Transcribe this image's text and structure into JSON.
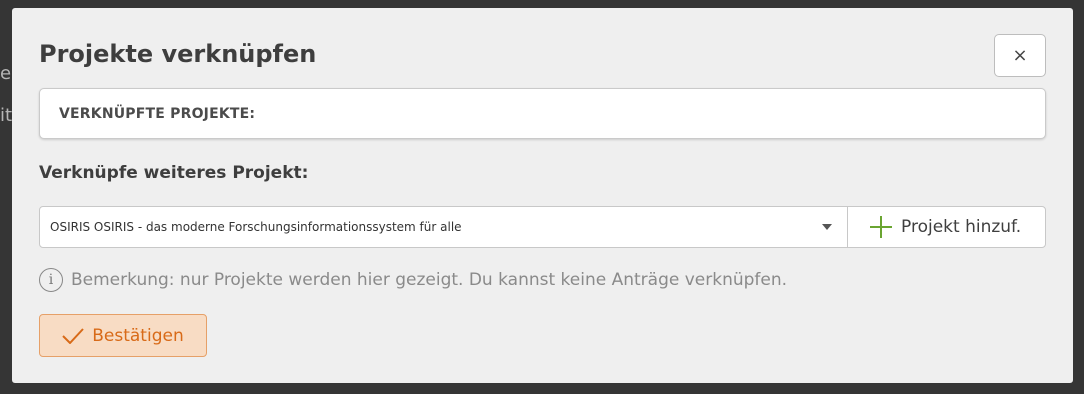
{
  "backdrop": {
    "fragment_1": "e",
    "fragment_2": "it"
  },
  "modal": {
    "title": "Projekte verknüpfen",
    "close_label": "×",
    "linked_projects_label": "VERKNÜPFTE PROJEKTE:",
    "link_more_label": "Verknüpfe weiteres Projekt:",
    "project_select": {
      "selected_value": "OSIRIS OSIRIS - das moderne Forschungsinformationssystem für alle"
    },
    "add_project_label": "Projekt hinzuf.",
    "note": "Bemerkung: nur Projekte werden hier gezeigt. Du kannst keine Anträge verknüpfen.",
    "confirm_label": "Bestätigen"
  },
  "icons": {
    "close": "close-icon",
    "caret": "chevron-down-icon",
    "plus": "plus-icon",
    "info": "info-icon",
    "check": "check-icon"
  },
  "colors": {
    "backdrop": "#353535",
    "modal_bg": "#efefef",
    "accent_orange": "#d86a18",
    "confirm_bg": "#f8dcc4",
    "plus_green": "#6aa531"
  }
}
